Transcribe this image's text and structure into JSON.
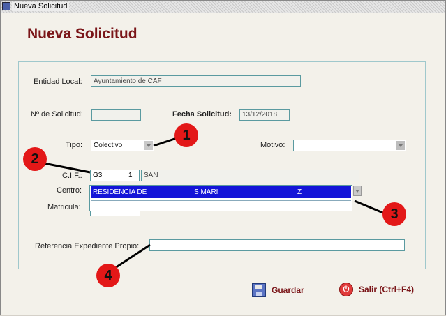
{
  "window": {
    "title": "Nueva Solicitud"
  },
  "heading": "Nueva Solicitud",
  "form": {
    "entidad": {
      "label": "Entidad Local:",
      "value": "Ayuntamiento de CAF"
    },
    "num_solicitud": {
      "label": "Nº de Solicitud:",
      "value": ""
    },
    "fecha": {
      "label": "Fecha Solicitud:",
      "value": "13/12/2018"
    },
    "tipo": {
      "label": "Tipo:",
      "value": "Colectivo"
    },
    "motivo": {
      "label": "Motivo:",
      "value": ""
    },
    "cif": {
      "label": "C.I.F.:",
      "code": "G3",
      "num": "1",
      "name": "SAN"
    },
    "centro": {
      "label": "Centro:",
      "selected_parts": [
        "RESIDENCIA DE",
        "S MARI",
        "Z"
      ]
    },
    "matricula": {
      "label": "Matricula:"
    },
    "referencia": {
      "label": "Referencia Expediente Propio:",
      "value": ""
    }
  },
  "annotations": [
    "1",
    "2",
    "3",
    "4"
  ],
  "buttons": {
    "save": {
      "label": "Guardar",
      "icon": "floppy-disk-icon"
    },
    "exit": {
      "label": "Salir (Ctrl+F4)",
      "icon": "power-exit-icon"
    }
  }
}
